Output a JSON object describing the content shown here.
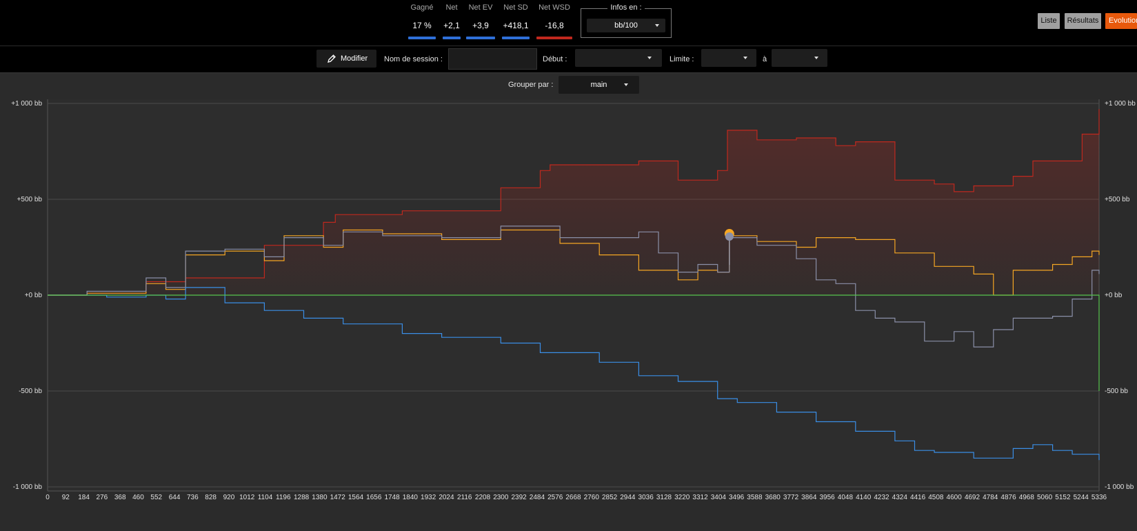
{
  "stats": [
    {
      "label": "Gagné",
      "value": "17 %",
      "color": "#2f6fd8"
    },
    {
      "label": "Net",
      "value": "+2,1",
      "color": "#2f6fd8"
    },
    {
      "label": "Net EV",
      "value": "+3,9",
      "color": "#2f6fd8"
    },
    {
      "label": "Net SD",
      "value": "+418,1",
      "color": "#2f6fd8"
    },
    {
      "label": "Net WSD",
      "value": "-16,8",
      "color": "#c0281e"
    }
  ],
  "infos": {
    "label": "Infos en :",
    "value": "bb/100"
  },
  "view_tabs": [
    "Liste",
    "Résultats",
    "Evolution"
  ],
  "toolbar": {
    "edit_label": "Modifier",
    "session_label": "Nom de session :",
    "session_value": "",
    "start_label": "Début :",
    "start_value": "",
    "limit_label": "Limite :",
    "limit_from": "",
    "to_label": "à",
    "limit_to": "",
    "group_label": "Grouper par :",
    "group_value": "main"
  },
  "colors": {
    "accent": "#e8590c",
    "net": "#f5a623",
    "ev": "#c0281e",
    "sd": "#8a8fa8",
    "wsd": "#3a8ee6",
    "rake": "#57c44e"
  },
  "chart_data": {
    "type": "line",
    "xlabel": "",
    "ylabel": "",
    "xlim": [
      0,
      5336
    ],
    "ylim": [
      -1000,
      1000
    ],
    "y_ticks": [
      1000,
      500,
      0,
      -500,
      -1000
    ],
    "y_tick_labels": [
      "+1 000 bb",
      "+500 bb",
      "+0 bb",
      "-500 bb",
      "-1 000 bb"
    ],
    "x_tick_labels": [
      "0",
      "92",
      "184",
      "276",
      "368",
      "460",
      "552",
      "644",
      "736",
      "828",
      "920",
      "1012",
      "1104",
      "1196",
      "1288",
      "1380",
      "1472",
      "1564",
      "1656",
      "1748",
      "1840",
      "1932",
      "2024",
      "2116",
      "2208",
      "2300",
      "2392",
      "2484",
      "2576",
      "2668",
      "2760",
      "2852",
      "2944",
      "3036",
      "3128",
      "3220",
      "3312",
      "3404",
      "3496",
      "3588",
      "3680",
      "3772",
      "3864",
      "3956",
      "4048",
      "4140",
      "4232",
      "4324",
      "4416",
      "4508",
      "4600",
      "4692",
      "4784",
      "4876",
      "4968",
      "5060",
      "5152",
      "5244",
      "5336"
    ],
    "grid": true,
    "marker": {
      "x": 3460,
      "y": 320
    },
    "series": [
      {
        "color": "#c0281e",
        "x": [
          0,
          200,
          500,
          700,
          1100,
          1400,
          1460,
          1800,
          2300,
          2500,
          2550,
          2800,
          3000,
          3200,
          3400,
          3450,
          3600,
          3800,
          4000,
          4100,
          4300,
          4500,
          4600,
          4700,
          4900,
          5000,
          5150,
          5250,
          5336
        ],
        "y": [
          0,
          10,
          70,
          90,
          260,
          380,
          420,
          440,
          560,
          650,
          680,
          680,
          700,
          600,
          650,
          860,
          810,
          820,
          780,
          800,
          600,
          580,
          540,
          570,
          620,
          700,
          700,
          840,
          970
        ]
      },
      {
        "color": "#f5a623",
        "x": [
          0,
          200,
          500,
          600,
          700,
          900,
          1100,
          1200,
          1400,
          1500,
          1700,
          2000,
          2300,
          2600,
          2800,
          3000,
          3200,
          3300,
          3400,
          3460,
          3600,
          3800,
          3900,
          4100,
          4300,
          4500,
          4700,
          4800,
          4900,
          5100,
          5200,
          5300,
          5336
        ],
        "y": [
          0,
          10,
          60,
          30,
          210,
          230,
          180,
          310,
          250,
          340,
          320,
          290,
          340,
          270,
          210,
          130,
          80,
          130,
          120,
          310,
          280,
          250,
          300,
          290,
          220,
          150,
          110,
          0,
          130,
          160,
          200,
          230,
          210
        ]
      },
      {
        "color": "#8a8fa8",
        "x": [
          0,
          200,
          500,
          600,
          700,
          900,
          1100,
          1200,
          1400,
          1500,
          1700,
          2000,
          2300,
          2600,
          2800,
          3000,
          3100,
          3200,
          3300,
          3400,
          3460,
          3600,
          3800,
          3900,
          4000,
          4100,
          4200,
          4300,
          4450,
          4600,
          4700,
          4800,
          4900,
          5000,
          5100,
          5200,
          5300,
          5336
        ],
        "y": [
          0,
          20,
          90,
          40,
          230,
          240,
          200,
          300,
          260,
          330,
          310,
          300,
          360,
          300,
          300,
          330,
          220,
          120,
          160,
          120,
          300,
          260,
          190,
          80,
          60,
          -80,
          -120,
          -140,
          -240,
          -190,
          -270,
          -180,
          -120,
          -120,
          -110,
          -20,
          130,
          110
        ]
      },
      {
        "color": "#3a8ee6",
        "x": [
          0,
          300,
          500,
          600,
          700,
          900,
          1100,
          1300,
          1500,
          1800,
          2000,
          2300,
          2500,
          2800,
          3000,
          3200,
          3400,
          3500,
          3700,
          3900,
          4100,
          4300,
          4400,
          4500,
          4700,
          4900,
          5000,
          5100,
          5200,
          5336
        ],
        "y": [
          0,
          -10,
          0,
          -20,
          40,
          -40,
          -80,
          -120,
          -150,
          -200,
          -220,
          -250,
          -300,
          -350,
          -420,
          -450,
          -540,
          -560,
          -610,
          -660,
          -710,
          -760,
          -810,
          -820,
          -850,
          -800,
          -780,
          -810,
          -830,
          -860
        ]
      },
      {
        "color": "#57c44e",
        "x": [
          0,
          5336
        ],
        "y": [
          0,
          -500
        ]
      }
    ]
  }
}
